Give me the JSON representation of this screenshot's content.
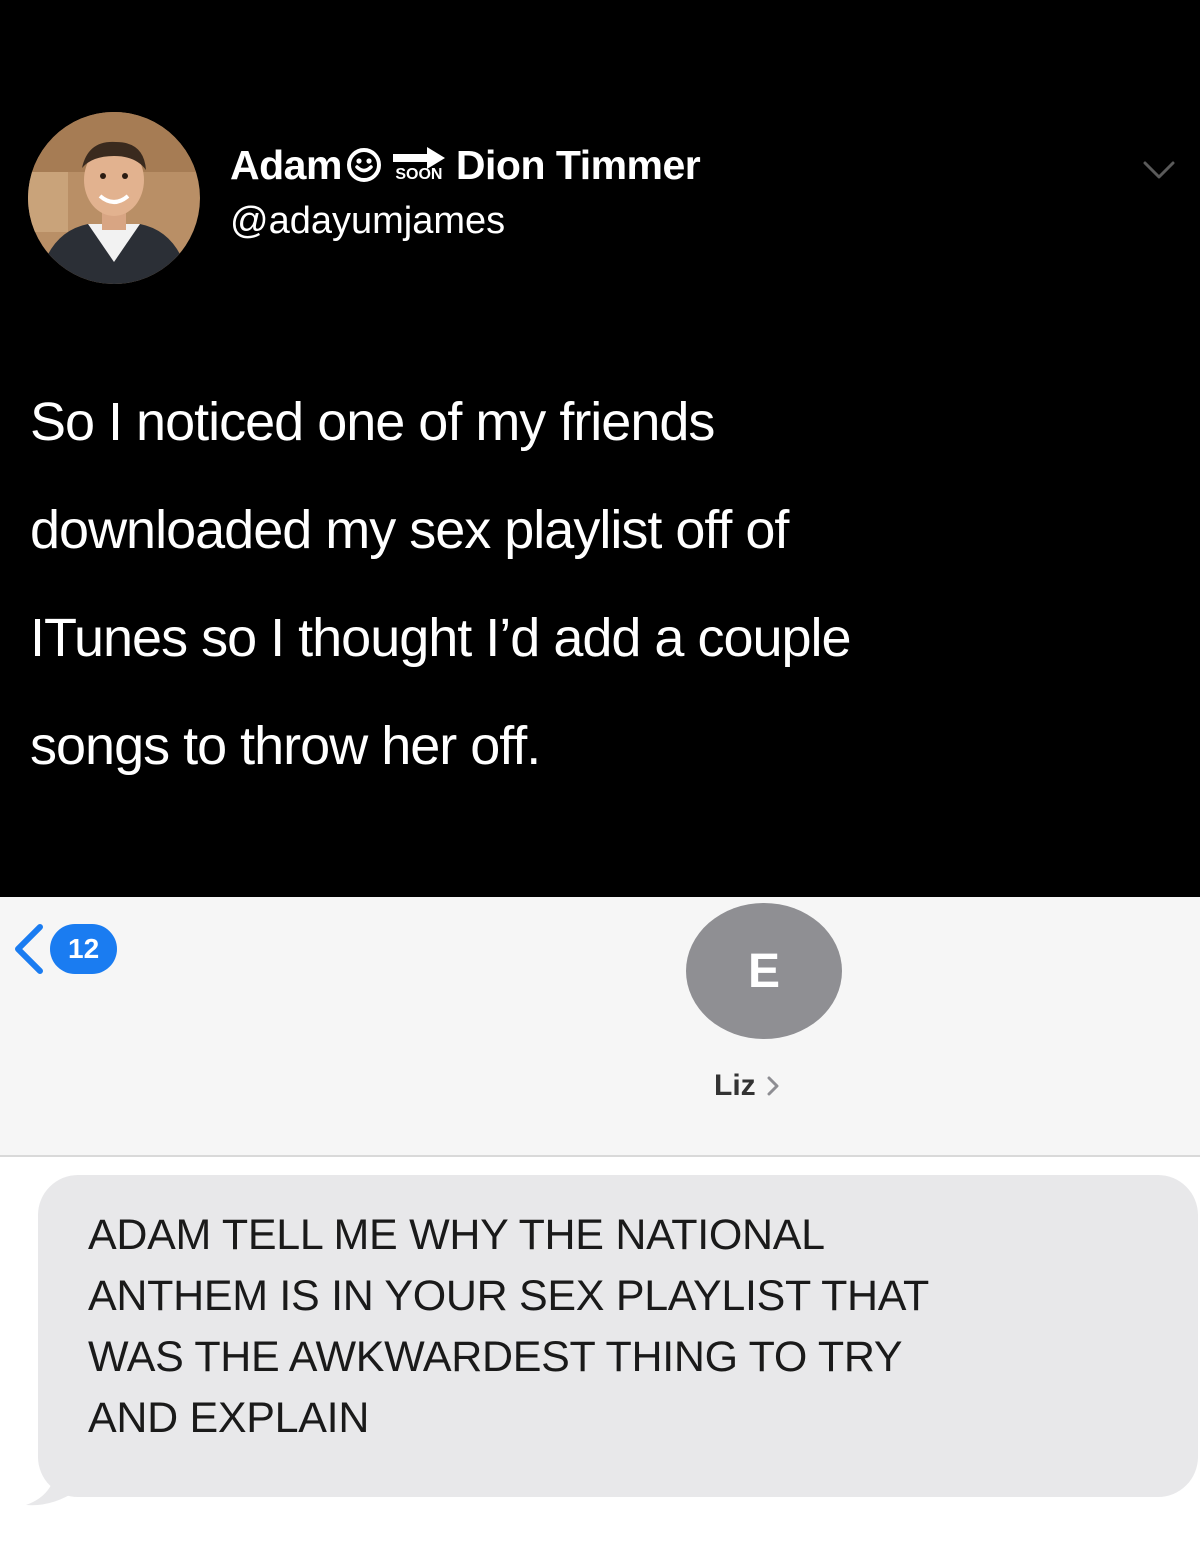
{
  "tweet": {
    "display_name_part1": "Adam",
    "smiley_icon": "smiley-icon",
    "soon_label": "SOON",
    "arrow_icon": "arrow-right-icon",
    "display_name_part2": "Dion Timmer",
    "handle": "@adayumjames",
    "menu_icon": "chevron-down-icon",
    "body_lines": [
      "So I noticed one of my friends",
      "downloaded my sex playlist off of",
      "ITunes so I thought I’d add a couple",
      "songs to throw her off."
    ]
  },
  "messages": {
    "back_icon": "chevron-left-icon",
    "unread_count": "12",
    "contact_initial": "E",
    "contact_name": "Liz",
    "contact_chevron": "chevron-right-icon",
    "message_lines": [
      "ADAM TELL ME WHY THE NATIONAL",
      "ANTHEM IS IN YOUR SEX PLAYLIST THAT",
      "WAS THE AWKWARDEST THING TO TRY",
      "AND EXPLAIN"
    ]
  },
  "colors": {
    "tweet_background": "#000000",
    "tweet_text": "#ffffff",
    "ios_blue": "#1a7cf1",
    "avatar_gray": "#8f8f93",
    "bubble_gray": "#e8e8ea"
  }
}
